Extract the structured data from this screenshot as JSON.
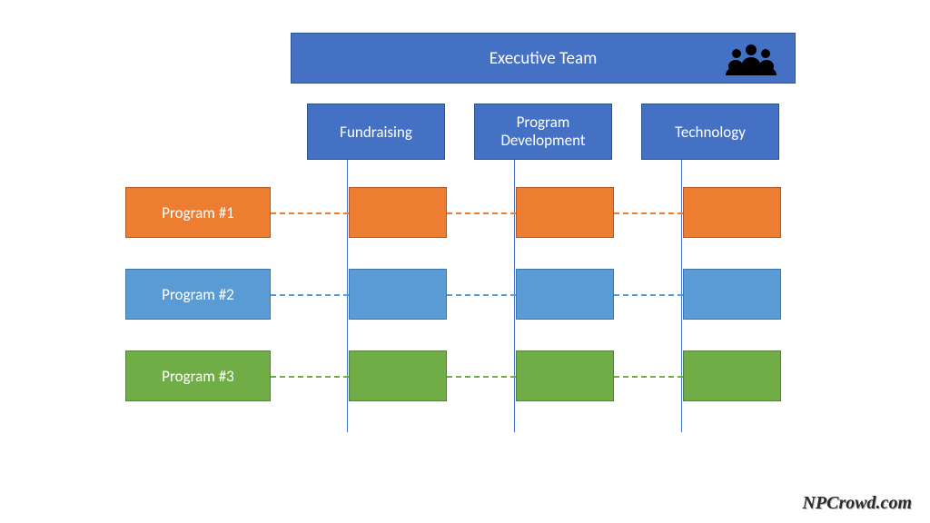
{
  "header": {
    "title": "Executive Team"
  },
  "departments": {
    "fundraising": "Fundraising",
    "program_dev": "Program Development",
    "technology": "Technology"
  },
  "programs": {
    "p1": "Program #1",
    "p2": "Program #2",
    "p3": "Program #3"
  },
  "footer": "NPCrowd.com",
  "colors": {
    "blue": "#4471c4",
    "orange": "#ed7d31",
    "skyblue": "#5b9bd5",
    "green": "#70ad47"
  }
}
